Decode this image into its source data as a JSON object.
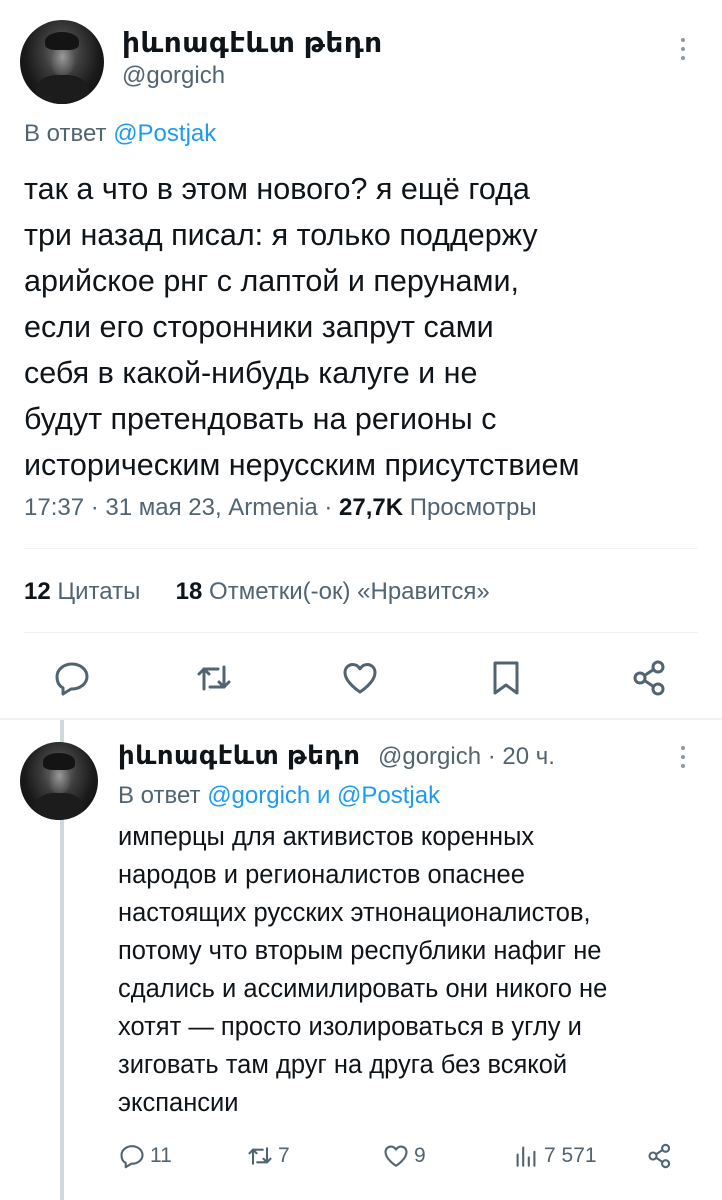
{
  "main_tweet": {
    "display_name": "իևոագէևտ թեդո",
    "handle": "@gorgich",
    "reply_to_prefix": "В ответ",
    "reply_to_mention": "@Postjak",
    "text_lines": [
      "так а что в этом нового? я ещё года",
      "три назад писал: я только поддержу",
      "арийское рнг с лаптой и перунами,",
      "если его сторонники запрут сами",
      "себя в какой-нибудь калуге и не",
      "будут претендовать на регионы с",
      "историческим нерусским присутствием"
    ],
    "meta_time": "17:37 · 31 мая 23, Armenia · ",
    "views_count": "27,7K",
    "views_label": "Просмотры",
    "quotes_count": "12",
    "quotes_label": "Цитаты",
    "likes_count": "18",
    "likes_label": "Отметки(-ок) «Нравится»",
    "icons": [
      "reply-icon",
      "retweet-icon",
      "like-icon",
      "bookmark-icon",
      "share-icon"
    ]
  },
  "reply_tweet": {
    "display_name": "իևոագէևտ թեդո",
    "handle_time": "@gorgich · 20 ч.",
    "reply_to_prefix": "В ответ",
    "reply_to_mention_1": "@gorgich",
    "reply_to_and": "и",
    "reply_to_mention_2": "@Postjak",
    "text_lines": [
      "имперцы для активистов коренных",
      "народов и регионалистов опаснее",
      "настоящих русских этнонационалистов,",
      "потому что вторым республики нафиг не",
      "сдались и ассимилировать они никого не",
      "хотят — просто изолироваться в углу и",
      "зиговать там друг на друга без всякой",
      "экспансии"
    ],
    "replies": "11",
    "retweets": "7",
    "likes": "9",
    "views": "7 571"
  },
  "colors": {
    "text": "#0f1419",
    "secondary": "#536471",
    "accent": "#1d9bf0",
    "divider": "#eff3f4"
  }
}
